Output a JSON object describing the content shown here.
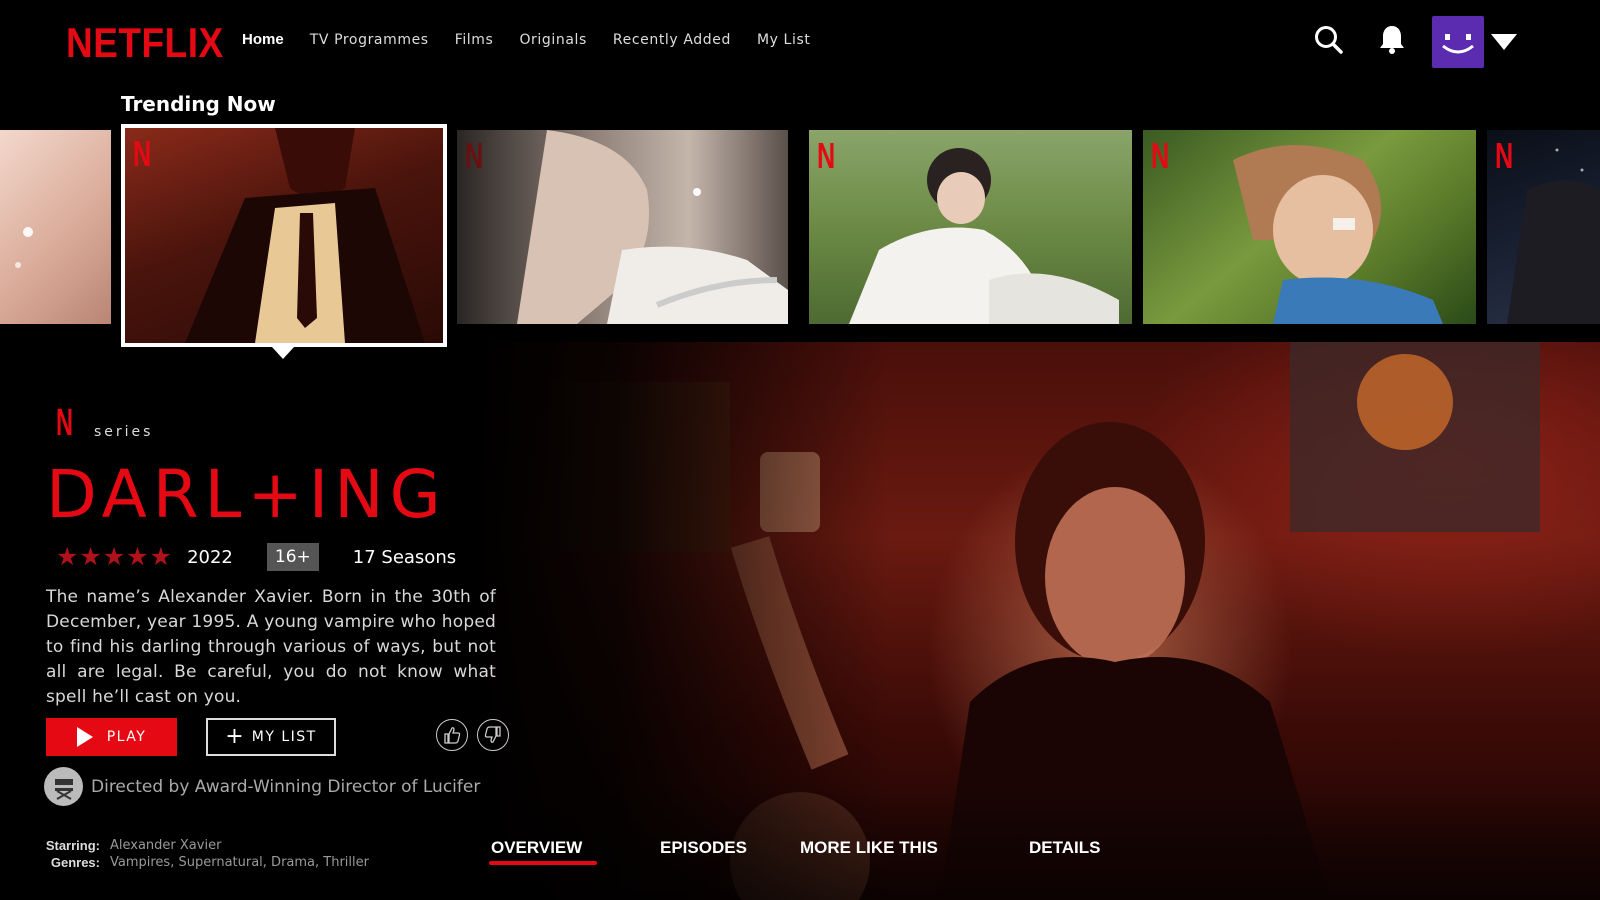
{
  "brand": {
    "name": "NETFLIX",
    "accent": "#e50914"
  },
  "nav": {
    "links": [
      "Home",
      "TV Programmes",
      "Films",
      "Originals",
      "Recently Added",
      "My List"
    ],
    "active": "Home",
    "icons": [
      "search-icon",
      "bell-icon",
      "profile-avatar",
      "caret-down-icon"
    ]
  },
  "trending": {
    "title": "Trending Now",
    "badge": "N",
    "items": [
      {
        "name": "partial-left-thumb",
        "palette": "#e9c2b4"
      },
      {
        "name": "darling-thumb",
        "palette": "#6a2a1a",
        "selected": true
      },
      {
        "name": "earring-thumb",
        "palette": "#b9a79c"
      },
      {
        "name": "grass-thumb",
        "palette": "#7a8e55"
      },
      {
        "name": "sun-thumb",
        "palette": "#6e8a3a"
      },
      {
        "name": "partial-right-thumb",
        "palette": "#1b2130"
      }
    ]
  },
  "show": {
    "badge": "N",
    "type_label": "series",
    "title": "DARL+ING",
    "stars": "★★★★★",
    "rating_out_of_5": 5,
    "year": "2022",
    "age_rating": "16+",
    "seasons": "17 Seasons",
    "description": "The name’s Alexander Xavier.  Born in the 30th of December, year 1995. A young vampire who hoped to find his darling through various of ways, but not all are legal. Be careful, you do not know what spell he’ll cast on you.",
    "play_label": "PLAY",
    "mylist_label": "MY LIST",
    "director_note": "Directed by Award-Winning Director of Lucifer",
    "starring_label": "Starring:",
    "starring": "Alexander Xavier",
    "genres_label": "Genres:",
    "genres": "Vampires, Supernatural, Drama, Thriller"
  },
  "tabs": {
    "items": [
      "OVERVIEW",
      "EPISODES",
      "MORE LIKE THIS",
      "DETAILS"
    ],
    "active": "OVERVIEW"
  }
}
